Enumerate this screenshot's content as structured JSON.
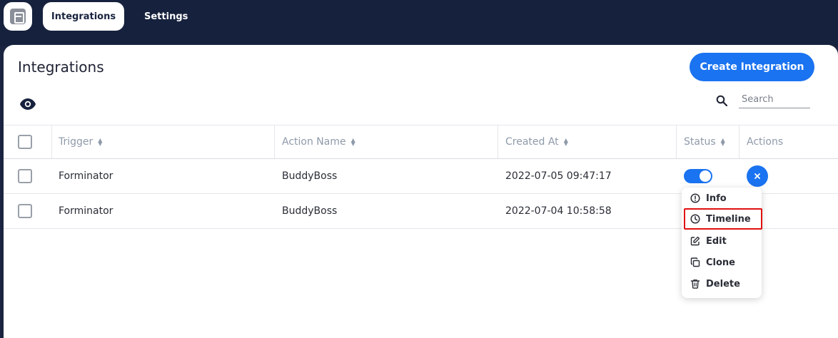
{
  "nav": {
    "tabs": [
      {
        "label": "Integrations",
        "active": true
      },
      {
        "label": "Settings",
        "active": false
      }
    ]
  },
  "header": {
    "title": "Integrations",
    "create_label": "Create Integration"
  },
  "search": {
    "placeholder": "Search"
  },
  "table": {
    "columns": [
      "Trigger",
      "Action Name",
      "Created At",
      "Status",
      "Actions"
    ],
    "rows": [
      {
        "trigger": "Forminator",
        "action": "BuddyBoss",
        "created": "2022-07-05 09:47:17",
        "status_on": true
      },
      {
        "trigger": "Forminator",
        "action": "BuddyBoss",
        "created": "2022-07-04 10:58:58",
        "status_on": true
      }
    ]
  },
  "menu": {
    "items": [
      {
        "label": "Info",
        "icon": "info-icon"
      },
      {
        "label": "Timeline",
        "icon": "clock-icon",
        "highlighted": true
      },
      {
        "label": "Edit",
        "icon": "edit-icon"
      },
      {
        "label": "Clone",
        "icon": "clone-icon"
      },
      {
        "label": "Delete",
        "icon": "trash-icon"
      }
    ]
  },
  "colors": {
    "topbar": "#16213d",
    "accent": "#1a73f0",
    "highlight": "#e01010"
  }
}
